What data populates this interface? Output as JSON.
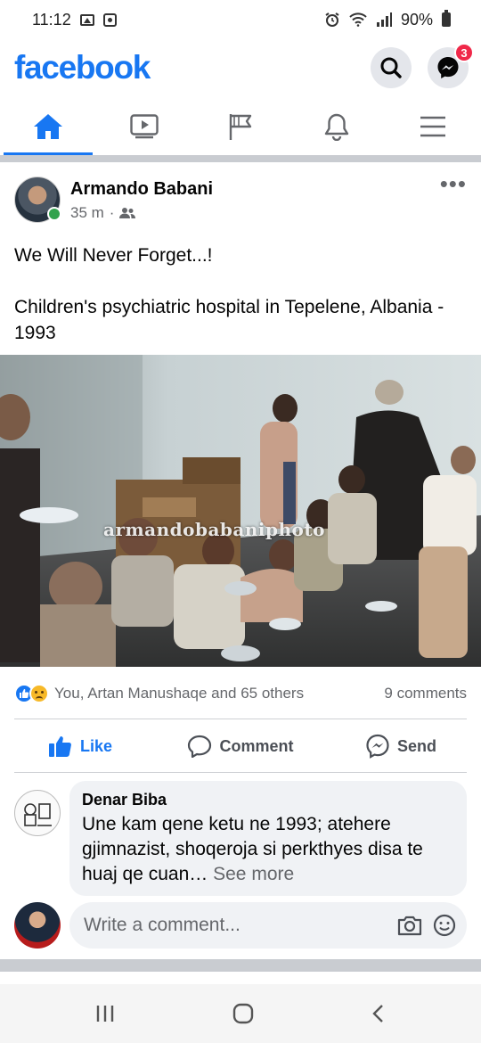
{
  "status_bar": {
    "time": "11:12",
    "battery": "90%",
    "icons": [
      "gallery-icon",
      "screen-record-icon",
      "alarm-icon",
      "wifi-icon",
      "signal-icon",
      "battery-icon"
    ]
  },
  "header": {
    "logo": "facebook",
    "messenger_badge": "3",
    "icons": [
      "search-icon",
      "messenger-icon"
    ],
    "brand_color": "#1877f2"
  },
  "nav": {
    "tabs": [
      {
        "name": "home",
        "icon": "home-icon",
        "active": true
      },
      {
        "name": "watch",
        "icon": "video-icon",
        "active": false
      },
      {
        "name": "pages",
        "icon": "flag-icon",
        "active": false
      },
      {
        "name": "notifications",
        "icon": "bell-icon",
        "active": false
      },
      {
        "name": "menu",
        "icon": "hamburger-icon",
        "active": false
      }
    ]
  },
  "post": {
    "author": "Armando Babani",
    "time": "35 m",
    "separator": "·",
    "audience_icon": "friends-icon",
    "text_line1": "We Will Never Forget...!",
    "text_line2": "Children's psychiatric hospital in Tepelene, Albania - 1993",
    "photo_watermark": "armandobabaniphoto",
    "reactions_text": "You, Artan Manushaqe and 65 others",
    "comments_count": "9 comments",
    "actions": {
      "like": "Like",
      "comment": "Comment",
      "send": "Send"
    }
  },
  "comment": {
    "author": "Denar Biba",
    "text": "Une kam qene ketu ne 1993; atehere gjimnazist, shoqeroja si perkthyes disa te huaj qe cuan…",
    "see_more": "See more"
  },
  "composer": {
    "placeholder": "Write a comment..."
  }
}
